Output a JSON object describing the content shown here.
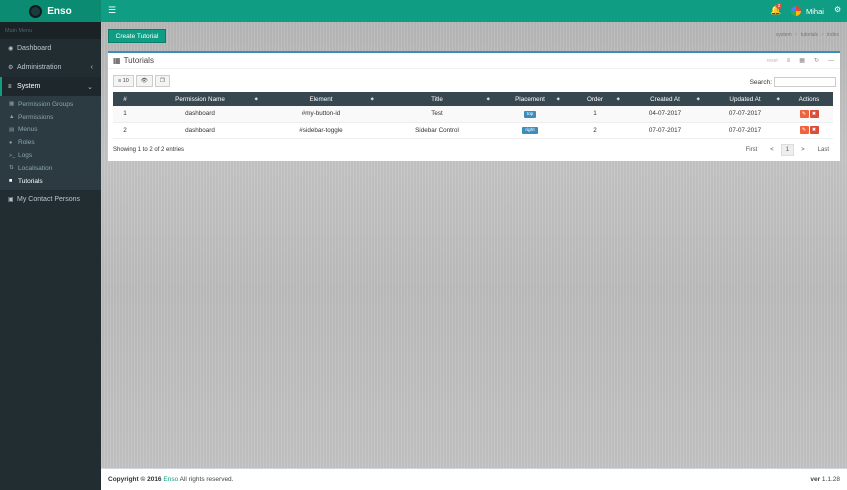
{
  "app": {
    "name": "Enso",
    "user": "Mihai",
    "notifications": "2"
  },
  "sidebar": {
    "header": "Main Menu",
    "items": [
      {
        "label": "Dashboard",
        "icon": "dashboard-icon"
      },
      {
        "label": "Administration",
        "icon": "cogs-icon"
      },
      {
        "label": "System",
        "icon": "sliders-icon"
      }
    ],
    "system_sub": [
      {
        "label": "Permission Groups"
      },
      {
        "label": "Permissions"
      },
      {
        "label": "Menus"
      },
      {
        "label": "Roles"
      },
      {
        "label": "Logs"
      },
      {
        "label": "Localisation"
      },
      {
        "label": "Tutorials"
      }
    ],
    "contacts": {
      "label": "My Contact Persons"
    }
  },
  "page": {
    "create_button": "Create Tutorial",
    "breadcrumb": [
      "system",
      "tutorials",
      "index"
    ]
  },
  "box": {
    "title": "Tutorials",
    "reset": "reset",
    "length_button": "10",
    "search_label": "Search:",
    "search_value": ""
  },
  "table": {
    "headers": [
      "#",
      "Permission Name",
      "Element",
      "Title",
      "Placement",
      "Order",
      "Created At",
      "Updated At",
      "Actions"
    ],
    "rows": [
      {
        "num": "1",
        "permission": "dashboard",
        "element": "#my-button-id",
        "title": "Test",
        "placement": "top",
        "order": "1",
        "created": "04-07-2017",
        "updated": "07-07-2017"
      },
      {
        "num": "2",
        "permission": "dashboard",
        "element": "#sidebar-toggle",
        "title": "Sidebar Control",
        "placement": "right",
        "order": "2",
        "created": "07-07-2017",
        "updated": "07-07-2017"
      }
    ]
  },
  "pagination": {
    "info": "Showing 1 to 2 of 2 entries",
    "first": "First",
    "prev": "<",
    "current": "1",
    "next": ">",
    "last": "Last"
  },
  "footer": {
    "copyright_prefix": "Copyright © 2016",
    "brand": "Enso",
    "rights": "All rights reserved.",
    "version_label": "ver",
    "version": "1.1.28"
  },
  "colors": {
    "accent": "#0f9d83",
    "sidebar": "#222d32",
    "table_header": "#37474f",
    "badge": "#3c8dbc",
    "danger": "#dd4b39"
  }
}
